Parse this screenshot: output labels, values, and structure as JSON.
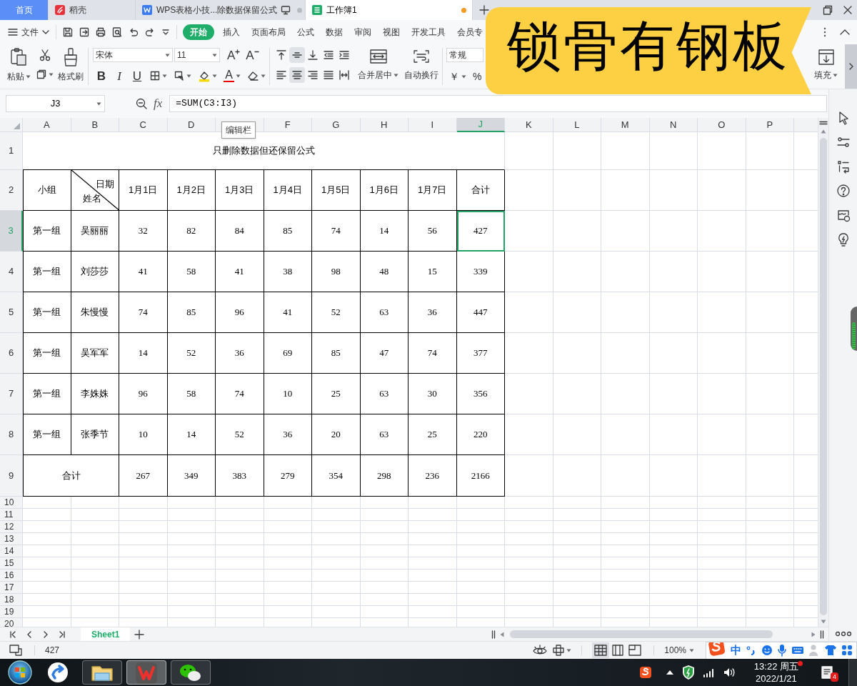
{
  "browser_tabs": [
    {
      "label": "首页",
      "kind": "home",
      "selected": false
    },
    {
      "label": "稻壳",
      "kind": "docer",
      "selected": false
    },
    {
      "label": "WPS表格小技...除数据保留公式",
      "kind": "writer",
      "selected": false
    },
    {
      "label": "工作簿1",
      "kind": "sheet",
      "selected": true,
      "unsaved": true
    }
  ],
  "file_menu": "文件",
  "ribbon_tabs": [
    {
      "label": "开始",
      "selected": true
    },
    {
      "label": "插入",
      "selected": false
    },
    {
      "label": "页面布局",
      "selected": false
    },
    {
      "label": "公式",
      "selected": false
    },
    {
      "label": "数据",
      "selected": false
    },
    {
      "label": "审阅",
      "selected": false
    },
    {
      "label": "视图",
      "selected": false
    },
    {
      "label": "开发工具",
      "selected": false
    },
    {
      "label": "会员专",
      "selected": false
    }
  ],
  "ribbon": {
    "paste": "粘贴",
    "format_painter": "格式刷",
    "font": "宋体",
    "font_size": "11",
    "grow_font": "A",
    "shrink_font": "A",
    "style_buttons": [
      {
        "kind": "bold",
        "label": "B"
      },
      {
        "kind": "italic",
        "label": "I"
      },
      {
        "kind": "underline",
        "label": "U"
      }
    ],
    "font_color": "A",
    "alignment": [
      {
        "kind": "top",
        "selected": false
      },
      {
        "kind": "middle",
        "selected": true
      },
      {
        "kind": "bottom",
        "selected": false
      },
      {
        "kind": "outdent",
        "selected": false
      },
      {
        "kind": "indent",
        "selected": false
      },
      {
        "kind": "left",
        "selected": false
      },
      {
        "kind": "center",
        "selected": true
      },
      {
        "kind": "right",
        "selected": false
      },
      {
        "kind": "justify",
        "selected": false
      },
      {
        "kind": "distributed",
        "selected": false
      }
    ],
    "merge": "合并居中",
    "wrap": "自动换行",
    "number_format": "常规",
    "currency": "￥",
    "percent": "%",
    "fill": "填充"
  },
  "name_box": "J3",
  "function_label": "fx",
  "formula": "=SUM(C3:I3)",
  "tooltip": "编辑栏",
  "column_headers": [
    {
      "label": "A",
      "selected": false
    },
    {
      "label": "B",
      "selected": false
    },
    {
      "label": "C",
      "selected": false
    },
    {
      "label": "D",
      "selected": false
    },
    {
      "selected": false
    },
    {
      "label": "F",
      "selected": false
    },
    {
      "label": "G",
      "selected": false
    },
    {
      "label": "H",
      "selected": false
    },
    {
      "label": "I",
      "selected": false
    },
    {
      "label": "J",
      "selected": true
    },
    {
      "label": "K",
      "selected": false
    },
    {
      "label": "L",
      "selected": false
    },
    {
      "label": "M",
      "selected": false
    },
    {
      "label": "N",
      "selected": false
    },
    {
      "label": "O",
      "selected": false
    },
    {
      "label": "P",
      "selected": false
    }
  ],
  "row_headers": [
    {
      "label": "1",
      "selected": false
    },
    {
      "label": "2",
      "selected": false
    },
    {
      "label": "3",
      "selected": true
    },
    {
      "label": "4",
      "selected": false
    },
    {
      "label": "5",
      "selected": false
    },
    {
      "label": "6",
      "selected": false
    },
    {
      "label": "7",
      "selected": false
    },
    {
      "label": "8",
      "selected": false
    },
    {
      "label": "9",
      "selected": false
    },
    {
      "label": "10",
      "selected": false
    },
    {
      "label": "11",
      "selected": false
    },
    {
      "label": "12",
      "selected": false
    },
    {
      "label": "13",
      "selected": false
    },
    {
      "label": "14",
      "selected": false
    },
    {
      "label": "15",
      "selected": false
    },
    {
      "label": "16",
      "selected": false
    },
    {
      "label": "17",
      "selected": false
    },
    {
      "label": "18",
      "selected": false
    },
    {
      "label": "19",
      "selected": false
    },
    {
      "label": "20",
      "selected": false
    }
  ],
  "table": {
    "title": "只删除数据但还保留公式",
    "group_heading": "小组",
    "diagonal_top": "日期",
    "diagonal_bottom": "姓名",
    "dates": [
      "1月1日",
      "1月2日",
      "1月3日",
      "1月4日",
      "1月5日",
      "1月6日",
      "1月7日"
    ],
    "total_heading": "合计",
    "rows": [
      {
        "group": "第一组",
        "name": "吴丽丽",
        "values": [
          "32",
          "82",
          "84",
          "85",
          "74",
          "14",
          "56"
        ],
        "total": "427"
      },
      {
        "group": "第一组",
        "name": "刘莎莎",
        "values": [
          "41",
          "58",
          "41",
          "38",
          "98",
          "48",
          "15"
        ],
        "total": "339"
      },
      {
        "group": "第一组",
        "name": "朱慢慢",
        "values": [
          "74",
          "85",
          "96",
          "41",
          "52",
          "63",
          "36"
        ],
        "total": "447"
      },
      {
        "group": "第一组",
        "name": "吴军军",
        "values": [
          "14",
          "52",
          "36",
          "69",
          "85",
          "47",
          "74"
        ],
        "total": "377"
      },
      {
        "group": "第一组",
        "name": "李姝姝",
        "values": [
          "96",
          "58",
          "74",
          "10",
          "25",
          "63",
          "30"
        ],
        "total": "356"
      },
      {
        "group": "第一组",
        "name": "张季节",
        "values": [
          "10",
          "14",
          "52",
          "36",
          "20",
          "63",
          "25"
        ],
        "total": "220"
      }
    ],
    "footer": {
      "label": "合计",
      "values": [
        "267",
        "349",
        "383",
        "279",
        "354",
        "298",
        "236",
        "2166"
      ]
    }
  },
  "sheet_tabs": [
    {
      "label": "Sheet1",
      "selected": true
    }
  ],
  "status_bar": {
    "value": "427",
    "zoom": "100%",
    "views": [
      {
        "kind": "normal",
        "selected": true
      },
      {
        "kind": "page",
        "selected": false
      },
      {
        "kind": "break",
        "selected": false
      }
    ]
  },
  "ime": {
    "mode": "中"
  },
  "taskbar": {
    "apps": [
      {
        "kind": "browser",
        "running": false
      },
      {
        "kind": "explorer",
        "running": true,
        "selected": false
      },
      {
        "kind": "wps",
        "running": true,
        "selected": true
      },
      {
        "kind": "wechat",
        "running": true,
        "selected": false
      }
    ],
    "time": "13:22 周五",
    "date": "2022/1/21",
    "notification_count": "4"
  },
  "banner": "锁骨有钢板"
}
